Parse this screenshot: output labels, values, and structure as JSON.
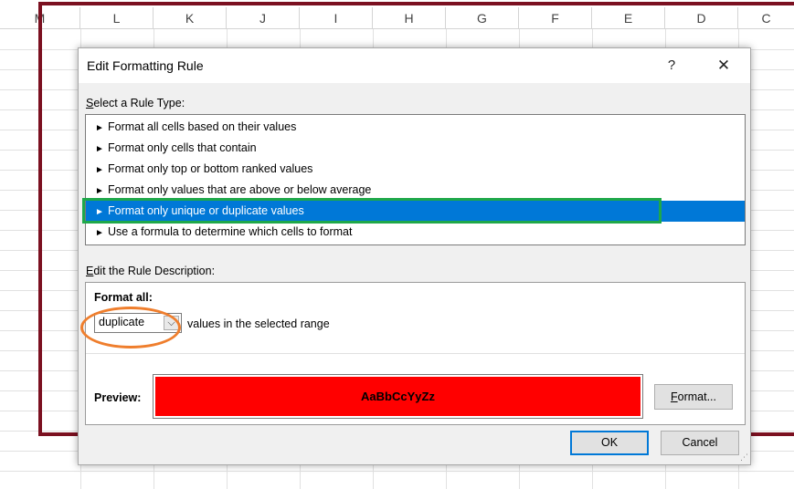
{
  "sheet": {
    "columns": [
      "M",
      "L",
      "K",
      "J",
      "I",
      "H",
      "G",
      "F",
      "E",
      "D",
      "C"
    ]
  },
  "dialog": {
    "title": "Edit Formatting Rule",
    "help_label": "?",
    "close_label": "✕",
    "rule_type_label_underlined": "S",
    "rule_type_label_rest": "elect a Rule Type:",
    "rule_types": [
      "Format all cells based on their values",
      "Format only cells that contain",
      "Format only top or bottom ranked values",
      "Format only values that are above or below average",
      "Format only unique or duplicate values",
      "Use a formula to determine which cells to format"
    ],
    "selected_rule_index": 4,
    "rule_arrow": "►",
    "desc_label_underlined": "E",
    "desc_label_rest": "dit the Rule Description:",
    "format_all_label": "Format all:",
    "dropdown_value": "duplicate",
    "dropdown_arrow": "⌵",
    "values_text": "values in the selected range",
    "preview_label": "Preview:",
    "preview_text": "AaBbCcYyZz",
    "preview_color": "#ff0000",
    "format_button_underlined": "F",
    "format_button_rest": "ormat...",
    "ok_label": "OK",
    "cancel_label": "Cancel"
  },
  "annotations": {
    "frame_color": "#7b1020",
    "highlight_color": "#1fa84a",
    "oval_color": "#ef7e2d"
  }
}
